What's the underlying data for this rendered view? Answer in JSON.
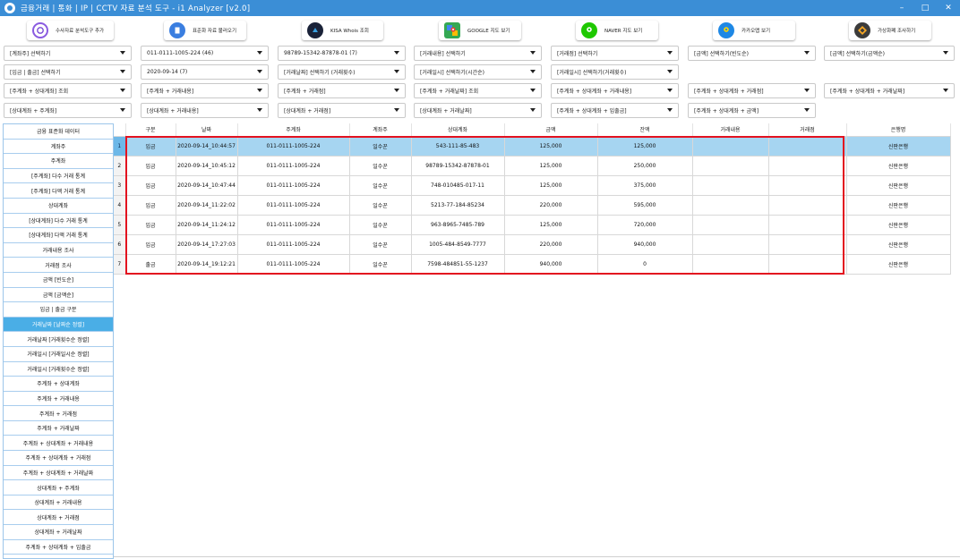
{
  "window": {
    "title": "금융거래 | 통화 | IP | CCTV 자료 분석 도구 - i1 Analyzer [v2.0]",
    "minimize": "–",
    "maximize": "□",
    "close": "✕"
  },
  "toolbar": [
    {
      "label": "수사자료 분석도구 추가",
      "icon": "analyzer-logo-icon",
      "color": "#7a4bd6"
    },
    {
      "label": "표준화 자료 불러오기",
      "icon": "document-icon",
      "color": "#3a7ee0"
    },
    {
      "label": "KISA Whois 조회",
      "icon": "kisa-logo-icon",
      "color": "#1a2238"
    },
    {
      "label": "GOOGLE 지도 보기",
      "icon": "google-maps-icon",
      "color": "#34a853"
    },
    {
      "label": "NAVER 지도 보기",
      "icon": "naver-map-icon",
      "color": "#1ec800"
    },
    {
      "label": "카카오맵 보기",
      "icon": "kakao-map-icon",
      "color": "#1e88e5"
    },
    {
      "label": "가상화폐 조사하기",
      "icon": "crypto-icon",
      "color": "#3b3b3b"
    }
  ],
  "filters": {
    "row1": [
      "[계좌주] 선택하기",
      "011-0111-1005-224 (46)",
      "98789-15342-87878-01 (7)",
      "[거래내용] 선택하기",
      "[거래점] 선택하기",
      "[금액] 선택하기(빈도순)",
      "[금액] 선택하기(금액순)"
    ],
    "row2": [
      "[입금 | 출금] 선택하기",
      "2020-09-14 (7)",
      "[거래날짜] 선택하기 (거래횟수)",
      "[거래일시] 선택하기(시간순)",
      "[거래일시] 선택하기(거래횟수)"
    ],
    "row3": [
      "[주계좌 + 상대계좌] 조회",
      "[주계좌 + 거래내용]",
      "[주계좌 + 거래점]",
      "[주계좌 + 거래날짜] 조회",
      "[주계좌 + 상대계좌 + 거래내용]",
      "[주계좌 + 상대계좌 + 거래점]",
      "[주계좌 + 상대계좌 + 거래날짜]"
    ],
    "row4": [
      "[상대계좌 + 주계좌]",
      "[상대계좌 + 거래내용]",
      "[상대계좌 + 거래점]",
      "[상대계좌 + 거래날짜]",
      "[주계좌 + 상대계좌 + 입출금]",
      "[주계좌 + 상대계좌 + 금액]"
    ]
  },
  "sidebar": {
    "active_index": 14,
    "items": [
      "금융 표준화 데이터",
      "계좌주",
      "주계좌",
      "[주계좌] 다수 거래 통계",
      "[주계좌] 다액 거래 통계",
      "상대계좌",
      "[상대계좌] 다수 거래 통계",
      "[상대계좌] 다액 거래 통계",
      "거래내용 조사",
      "거래점 조사",
      "금액 [빈도순]",
      "금액 [금액순]",
      "입금 | 출금 구분",
      "거래날짜 [날짜순 정렬]",
      "거래날짜 [거래횟수순 정렬]",
      "거래일시 [거래일시순 정렬]",
      "거래일시 [거래횟수순 정렬]",
      "주계좌 + 상대계좌",
      "주계좌 + 거래내용",
      "주계좌 + 거래점",
      "주계좌 + 거래날짜",
      "주계좌 + 상대계좌 + 거래내용",
      "주계좌 + 상대계좌 + 거래점",
      "주계좌 + 상대계좌 + 거래날짜",
      "상대계좌 + 주계좌",
      "상대계좌 + 거래내용",
      "상대계좌 + 거래점",
      "상대계좌 + 거래날짜",
      "주계좌 + 상대계좌 + 입출금"
    ]
  },
  "table": {
    "columns": [
      "",
      "구분",
      "날짜",
      "주계좌",
      "계좌주",
      "상대계좌",
      "금액",
      "잔액",
      "거래내용",
      "거래점",
      "은행명"
    ],
    "selected_row": 0,
    "rows": [
      [
        "1",
        "입금",
        "2020-09-14_10:44:57",
        "011-0111-1005-224",
        "일수꾼",
        "543-111-85-483",
        "125,000",
        "125,000",
        "",
        "",
        "신판은행"
      ],
      [
        "2",
        "입금",
        "2020-09-14_10:45:12",
        "011-0111-1005-224",
        "일수꾼",
        "98789-15342-87878-01",
        "125,000",
        "250,000",
        "",
        "",
        "신판은행"
      ],
      [
        "3",
        "입금",
        "2020-09-14_10:47:44",
        "011-0111-1005-224",
        "일수꾼",
        "748-010485-017-11",
        "125,000",
        "375,000",
        "",
        "",
        "신판은행"
      ],
      [
        "4",
        "입금",
        "2020-09-14_11:22:02",
        "011-0111-1005-224",
        "일수꾼",
        "5213-77-184-85234",
        "220,000",
        "595,000",
        "",
        "",
        "신판은행"
      ],
      [
        "5",
        "입금",
        "2020-09-14_11:24:12",
        "011-0111-1005-224",
        "일수꾼",
        "963-8965-7485-789",
        "125,000",
        "720,000",
        "",
        "",
        "신판은행"
      ],
      [
        "6",
        "입금",
        "2020-09-14_17:27:03",
        "011-0111-1005-224",
        "일수꾼",
        "1005-484-8549-7777",
        "220,000",
        "940,000",
        "",
        "",
        "신판은행"
      ],
      [
        "7",
        "출금",
        "2020-09-14_19:12:21",
        "011-0111-1005-224",
        "일수꾼",
        "7598-484851-55-1237",
        "940,000",
        "0",
        "",
        "",
        "신판은행"
      ]
    ]
  },
  "colors": {
    "titlebar": "#3b8ed6",
    "sidebar_active": "#4aaee6",
    "row_selected": "#a6d5f1",
    "highlight_border": "#e3121f"
  }
}
